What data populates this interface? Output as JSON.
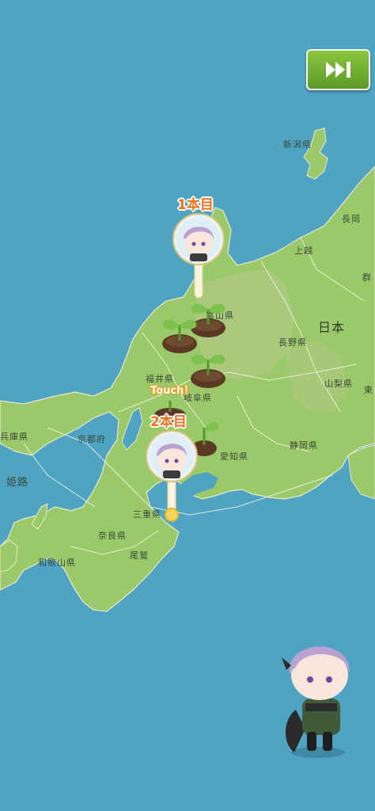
{
  "game": {
    "skip_button_icon": "fast-forward-icon",
    "pins": [
      {
        "label": "1本目",
        "avatar_icon": "character-avatar-icon"
      },
      {
        "label": "2本目",
        "avatar_icon": "character-avatar-icon"
      }
    ],
    "touch_label": "Touch！",
    "sprout_icon": "sprout-icon",
    "character_icon": "character-sprite-icon"
  },
  "map": {
    "country": "日本",
    "prefectures": [
      {
        "id": "niigata",
        "label": "新潟県"
      },
      {
        "id": "nagaoka",
        "label": "長岡"
      },
      {
        "id": "joetsu",
        "label": "上越"
      },
      {
        "id": "gunma",
        "label": "群"
      },
      {
        "id": "toyama",
        "label": "富山県"
      },
      {
        "id": "nagano",
        "label": "長野県"
      },
      {
        "id": "fukui",
        "label": "福井県"
      },
      {
        "id": "gifu",
        "label": "岐阜県"
      },
      {
        "id": "yamanashi",
        "label": "山梨県"
      },
      {
        "id": "tokyo",
        "label": "東"
      },
      {
        "id": "hyogo",
        "label": "兵庫県"
      },
      {
        "id": "kyoto",
        "label": "京都府"
      },
      {
        "id": "shizuoka",
        "label": "静岡県"
      },
      {
        "id": "aichi",
        "label": "愛知県"
      },
      {
        "id": "himeji",
        "label": "姫路"
      },
      {
        "id": "mie",
        "label": "三重県"
      },
      {
        "id": "nara",
        "label": "奈良県"
      },
      {
        "id": "owase",
        "label": "尾鷲"
      },
      {
        "id": "wakayama",
        "label": "和歌山県"
      }
    ]
  },
  "colors": {
    "sea": "#4fa4c4",
    "land": "#9bc96a",
    "accent_orange": "#f07020",
    "button_green": "#6aad2d"
  }
}
